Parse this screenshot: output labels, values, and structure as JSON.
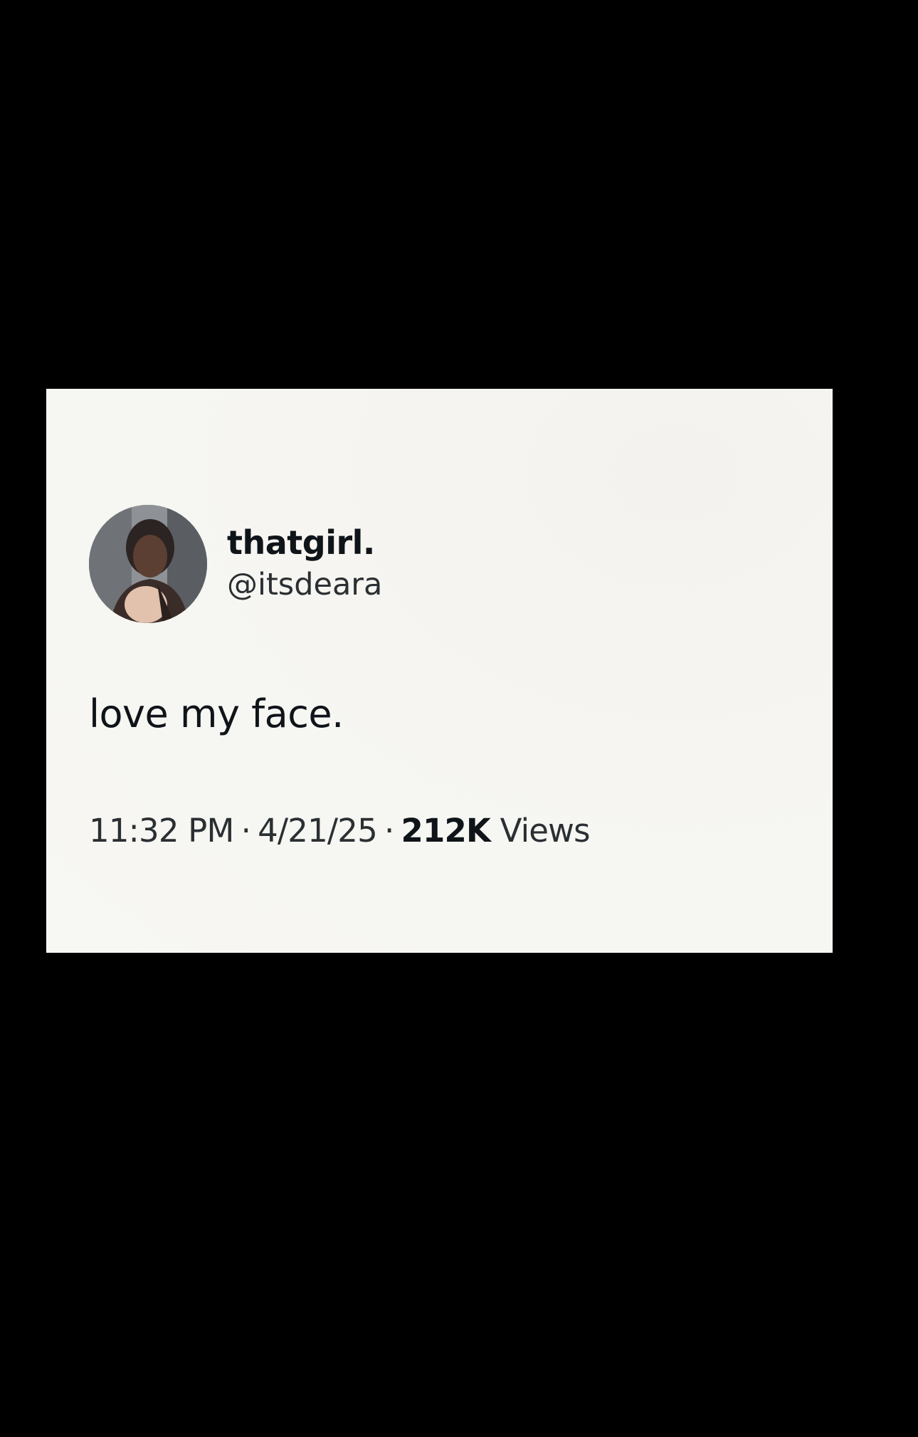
{
  "tweet": {
    "display_name": "thatgirl.",
    "handle": "@itsdeara",
    "text": "love my face.",
    "time": "11:32 PM",
    "separator": "·",
    "date": "4/21/25",
    "views_count": "212K",
    "views_label": "Views",
    "avatar_icon": "profile-photo"
  },
  "colors": {
    "background": "#000000",
    "card": "#f7f7f3",
    "text_primary": "#0f1419",
    "text_secondary": "#2a2f33"
  }
}
